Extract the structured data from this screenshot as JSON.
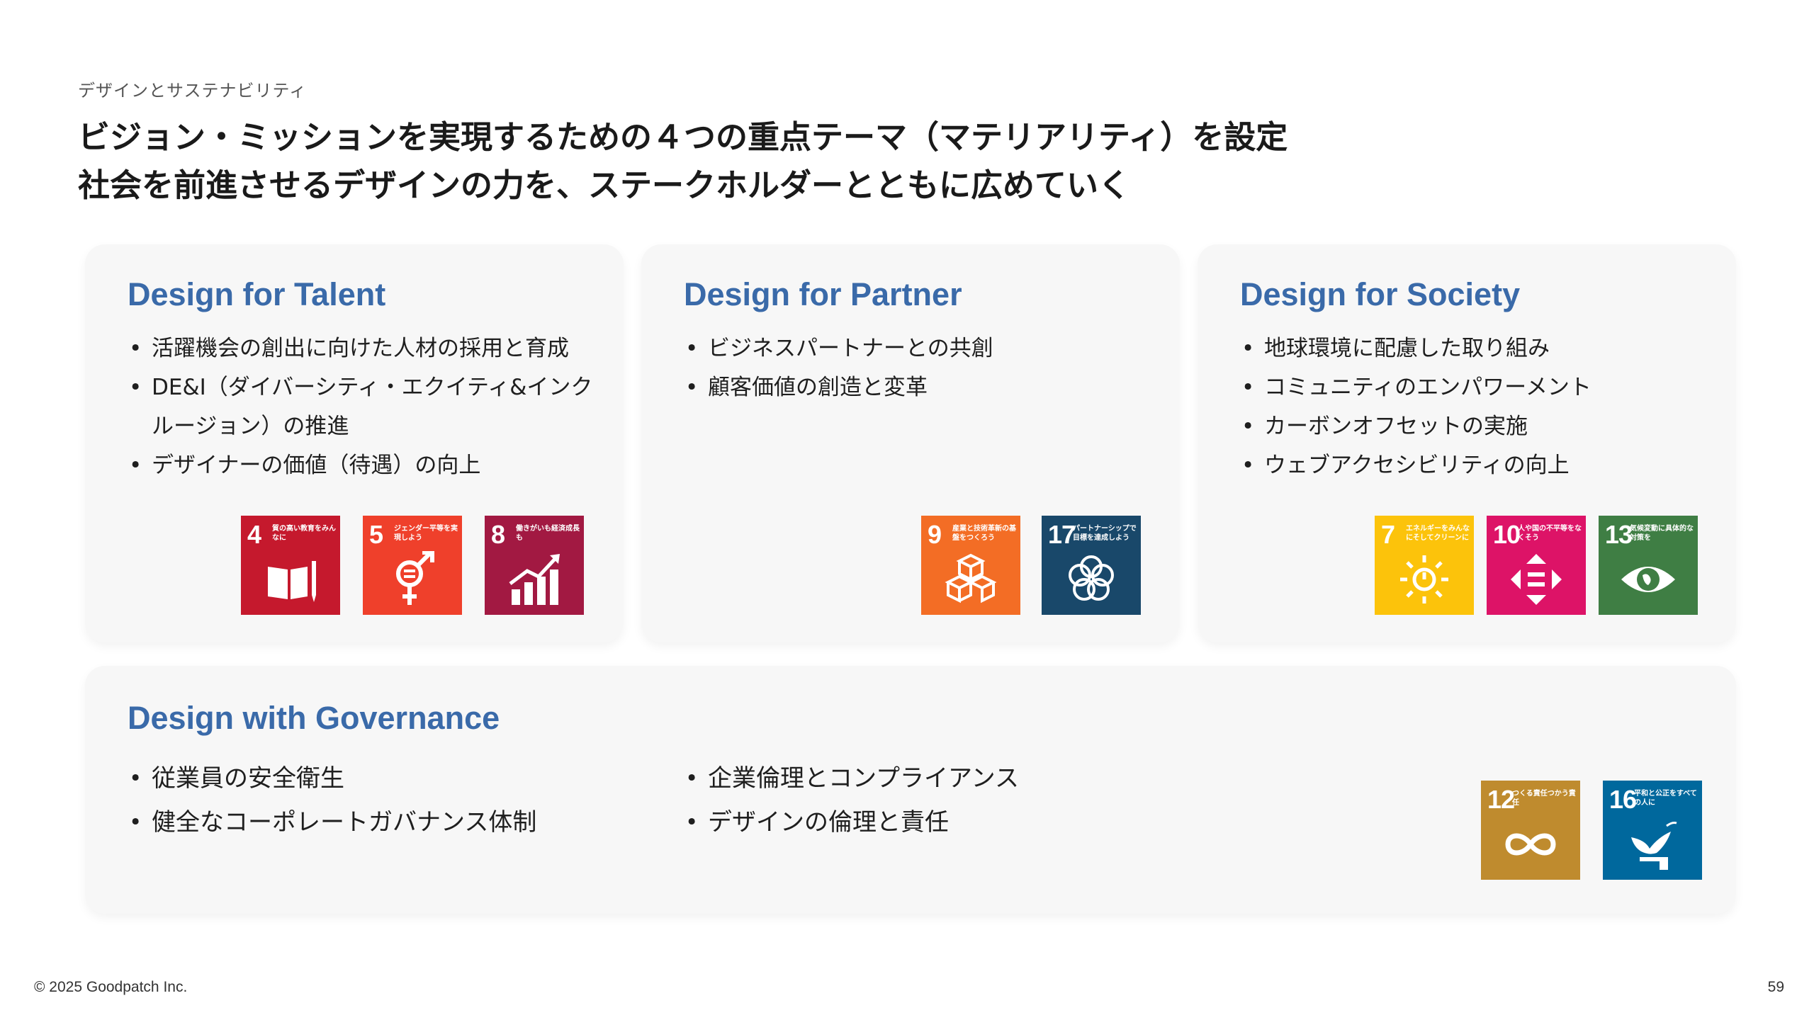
{
  "header": {
    "eyebrow": "デザインとサステナビリティ",
    "headline_line1": "ビジョン・ミッションを実現するための４つの重点テーマ（マテリアリティ）を設定",
    "headline_line2": "社会を前進させるデザインの力を、ステークホルダーとともに広めていく"
  },
  "cards": {
    "talent": {
      "title": "Design for Talent",
      "items": [
        "活躍機会の創出に向けた人材の採用と育成",
        "DE&I（ダイバーシティ・エクイティ&インクルージョン）の推進",
        "デザイナーの価値（待遇）の向上"
      ]
    },
    "partner": {
      "title": "Design for Partner",
      "items": [
        "ビジネスパートナーとの共創",
        "顧客価値の創造と変革"
      ]
    },
    "society": {
      "title": "Design for Society",
      "items": [
        "地球環境に配慮した取り組み",
        "コミュニティのエンパワーメント",
        "カーボンオフセットの実施",
        "ウェブアクセシビリティの向上"
      ]
    },
    "governance": {
      "title": "Design with Governance",
      "items_left": [
        "従業員の安全衛生",
        "健全なコーポレートガバナンス体制"
      ],
      "items_right": [
        "企業倫理とコンプライアンス",
        "デザインの倫理と責任"
      ]
    }
  },
  "sdgs": {
    "g4": {
      "num": "4",
      "caption": "質の高い教育をみんなに",
      "color": "#c5192d",
      "icon": "book-pencil-icon"
    },
    "g5": {
      "num": "5",
      "caption": "ジェンダー平等を実現しよう",
      "color": "#ef402b",
      "icon": "gender-equality-icon"
    },
    "g8": {
      "num": "8",
      "caption": "働きがいも経済成長も",
      "color": "#a21942",
      "icon": "growth-chart-icon"
    },
    "g9": {
      "num": "9",
      "caption": "産業と技術革新の基盤をつくろう",
      "color": "#f36d25",
      "icon": "cubes-icon"
    },
    "g17": {
      "num": "17",
      "caption": "パートナーシップで目標を達成しよう",
      "color": "#19486a",
      "icon": "rings-icon"
    },
    "g7": {
      "num": "7",
      "caption": "エネルギーをみんなにそしてクリーンに",
      "color": "#fcc30b",
      "icon": "sun-power-icon"
    },
    "g10": {
      "num": "10",
      "caption": "人や国の不平等をなくそう",
      "color": "#dd1367",
      "icon": "equality-arrows-icon"
    },
    "g13": {
      "num": "13",
      "caption": "気候変動に具体的な対策を",
      "color": "#3f7e44",
      "icon": "earth-eye-icon"
    },
    "g12": {
      "num": "12",
      "caption": "つくる責任つかう責任",
      "color": "#bf8b2e",
      "icon": "infinity-icon"
    },
    "g16": {
      "num": "16",
      "caption": "平和と公正をすべての人に",
      "color": "#00689d",
      "icon": "dove-icon"
    }
  },
  "footer": {
    "copyright": "© 2025 Goodpatch Inc.",
    "page": "59"
  }
}
